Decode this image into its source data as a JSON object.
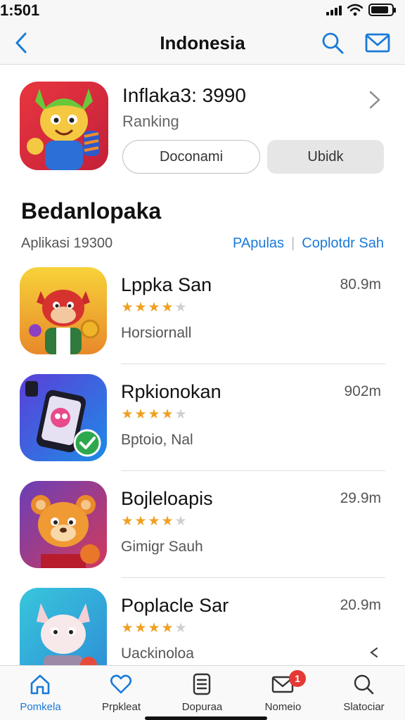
{
  "status_bar": {
    "time": "1:501"
  },
  "nav": {
    "title": "Indonesia"
  },
  "featured": {
    "title": "Inflaka3: 3990",
    "subtitle": "Ranking",
    "button_outline": "Doconami",
    "button_filled": "Ubidk"
  },
  "section": {
    "title": "Bedanlopaka",
    "subtitle": "Aplikasi 19300",
    "link_1": "PApulas",
    "link_2": "Coplotdr  Sah"
  },
  "apps": [
    {
      "name": "Lppka San",
      "rating": 3.5,
      "category": "Horsiornall",
      "size": "80.9m",
      "colors": [
        "#f7c531",
        "#e6892b"
      ]
    },
    {
      "name": "Rpkionokan",
      "rating": 4,
      "category": "Bptoio, Nal",
      "size": "902m",
      "colors": [
        "#5b3fd8",
        "#1e8be6"
      ]
    },
    {
      "name": "Bojleloapis",
      "rating": 4,
      "category": "Gimigr Sauh",
      "size": "29.9m",
      "colors": [
        "#6a3fb8",
        "#d23a5a"
      ]
    },
    {
      "name": "Poplacle Sar",
      "rating": 3.5,
      "category": "Uackinoloa",
      "size": "20.9m",
      "colors": [
        "#38c6dc",
        "#2e8fd6"
      ]
    }
  ],
  "tabs": [
    {
      "label": "Pomkela",
      "icon": "home-icon",
      "active": true
    },
    {
      "label": "Prpkleat",
      "icon": "heart-icon",
      "active": false
    },
    {
      "label": "Dopuraa",
      "icon": "document-icon",
      "active": false
    },
    {
      "label": "Nomeio",
      "icon": "mail-icon",
      "active": false,
      "badge": "1"
    },
    {
      "label": "Slatociar",
      "icon": "search-icon",
      "active": false
    }
  ],
  "colors": {
    "accent": "#1a7ad8",
    "star": "#f0a020",
    "badge": "#e53935"
  },
  "battery_level": 0.85
}
